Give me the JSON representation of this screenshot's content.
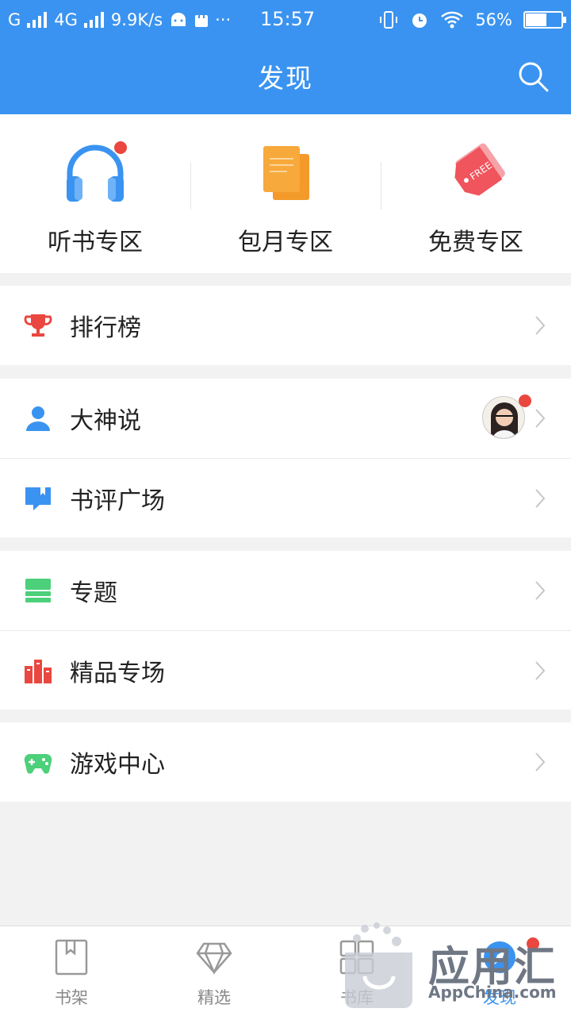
{
  "status_bar": {
    "carrier1": "G",
    "carrier2": "4G",
    "speed": "9.9K/s",
    "dots": "···",
    "time": "15:57",
    "battery": "56%"
  },
  "header": {
    "title": "发现"
  },
  "zones": [
    {
      "label": "听书专区",
      "icon": "headphones-icon",
      "badge": true
    },
    {
      "label": "包月专区",
      "icon": "books-icon",
      "badge": false
    },
    {
      "label": "免费专区",
      "icon": "free-tag-icon",
      "badge": false,
      "tag_text": "FREE"
    }
  ],
  "list": {
    "ranking": {
      "label": "排行榜",
      "icon": "trophy-icon",
      "color": "#e9473f"
    },
    "gods": {
      "label": "大神说",
      "icon": "person-icon",
      "color": "#3a93f0"
    },
    "reviews": {
      "label": "书评广场",
      "icon": "book-review-icon",
      "color": "#3a93f0"
    },
    "topics": {
      "label": "专题",
      "icon": "topic-icon",
      "color": "#4cd07a"
    },
    "premium": {
      "label": "精品专场",
      "icon": "books-stack-icon",
      "color": "#e9473f"
    },
    "games": {
      "label": "游戏中心",
      "icon": "gamepad-icon",
      "color": "#4cd07a"
    }
  },
  "bottom_nav": [
    {
      "label": "书架",
      "icon": "bookmark-book-icon"
    },
    {
      "label": "精选",
      "icon": "diamond-icon"
    },
    {
      "label": "书库",
      "icon": "grid-icon"
    },
    {
      "label": "发现",
      "icon": "compass-icon",
      "active": true
    }
  ],
  "watermark": {
    "text": "应用汇",
    "sub": "AppChina.com"
  },
  "colors": {
    "primary": "#3a93f0",
    "badge": "#e9473f",
    "green": "#4cd07a",
    "orange": "#f39a2b"
  }
}
